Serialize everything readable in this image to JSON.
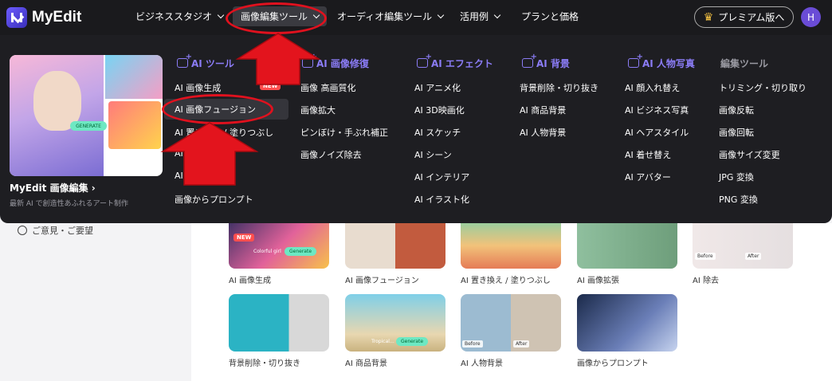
{
  "app": {
    "logo_text": "MyEdit"
  },
  "nav": {
    "items": [
      {
        "label": "ビジネススタジオ"
      },
      {
        "label": "画像編集ツール"
      },
      {
        "label": "オーディオ編集ツール"
      },
      {
        "label": "活用例"
      },
      {
        "label": "プランと価格"
      }
    ],
    "premium_label": "プレミアム版へ",
    "avatar_initial": "H"
  },
  "promo": {
    "title": "MyEdit 画像編集 ›",
    "subtitle": "最新 AI で創造性あふれるアート制作",
    "generate_label": "GENERATE"
  },
  "menu": {
    "columns": [
      {
        "heading": "AI ツール",
        "items": [
          "AI 画像生成",
          "AI 画像フュージョン",
          "AI 置き換え / 塗りつぶし",
          "AI",
          "AI",
          "画像からプロンプト"
        ],
        "new_badge": "NEW"
      },
      {
        "heading": "AI 画像修復",
        "items": [
          "画像 高画質化",
          "画像拡大",
          "ピンぼけ・手ぶれ補正",
          "画像ノイズ除去"
        ]
      },
      {
        "heading": "AI エフェクト",
        "items": [
          "AI アニメ化",
          "AI 3D映画化",
          "AI スケッチ",
          "AI シーン",
          "AI インテリア",
          "AI イラスト化"
        ]
      },
      {
        "heading": "AI 背景",
        "items": [
          "背景削除・切り抜き",
          "AI 商品背景",
          "AI 人物背景"
        ]
      },
      {
        "heading": "AI 人物写真",
        "items": [
          "AI 顔入れ替え",
          "AI ビジネス写真",
          "AI ヘアスタイル",
          "AI 着せ替え",
          "AI アバター"
        ]
      },
      {
        "heading": "編集ツール",
        "items": [
          "トリミング・切り取り",
          "画像反転",
          "画像回転",
          "画像サイズ変更",
          "JPG 変換",
          "PNG 変換"
        ]
      }
    ]
  },
  "sidebar": {
    "feedback_label": "ご意見・ご要望"
  },
  "cards": [
    {
      "label": "AI 画像生成",
      "new": "NEW",
      "caption": "Colorful girl",
      "button": "Generate"
    },
    {
      "label": "AI 画像フュージョン"
    },
    {
      "label": "AI 置き換え / 塗りつぶし"
    },
    {
      "label": "AI 画像拡張"
    },
    {
      "label": "AI 除去",
      "before": "Before",
      "after": "After"
    },
    {
      "label": "背景削除・切り抜き"
    },
    {
      "label": "AI 商品背景",
      "caption": "Tropical…",
      "button": "Generate"
    },
    {
      "label": "AI 人物背景",
      "before": "Before",
      "after": "After"
    },
    {
      "label": "画像からプロンプト"
    }
  ],
  "colors": {
    "accent": "#8b7cf6",
    "annotation": "#e0111e",
    "new_badge": "#ff4f4f"
  }
}
